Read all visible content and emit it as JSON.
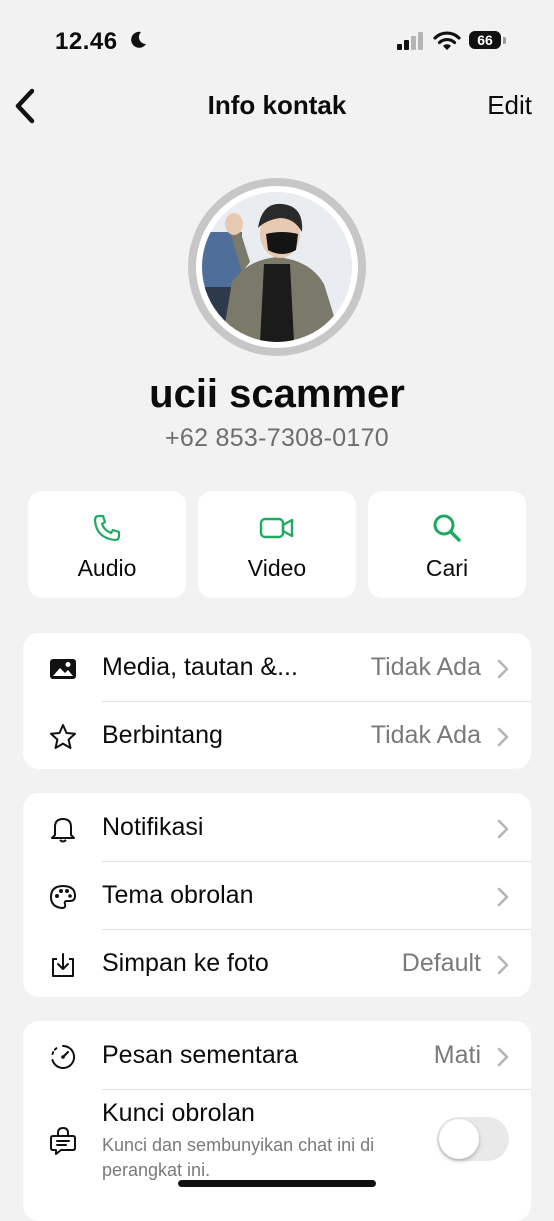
{
  "status_bar": {
    "time": "12.46",
    "battery": "66",
    "icons": [
      "moon-icon",
      "signal-icon",
      "wifi-icon",
      "battery-icon"
    ]
  },
  "nav": {
    "title": "Info kontak",
    "edit_label": "Edit",
    "back_icon": "chevron-left-icon"
  },
  "profile": {
    "name": "ucii scammer",
    "phone": "+62 853-7308-0170"
  },
  "actions": [
    {
      "label": "Audio",
      "icon": "phone-icon"
    },
    {
      "label": "Video",
      "icon": "video-icon"
    },
    {
      "label": "Cari",
      "icon": "search-icon"
    }
  ],
  "group1": [
    {
      "label": "Media, tautan &...",
      "value": "Tidak Ada",
      "icon": "image-icon"
    },
    {
      "label": "Berbintang",
      "value": "Tidak Ada",
      "icon": "star-icon"
    }
  ],
  "group2": [
    {
      "label": "Notifikasi",
      "value": "",
      "icon": "bell-icon"
    },
    {
      "label": "Tema obrolan",
      "value": "",
      "icon": "palette-icon"
    },
    {
      "label": "Simpan ke foto",
      "value": "Default",
      "icon": "save-download-icon"
    }
  ],
  "group3": {
    "disappearing": {
      "label": "Pesan sementara",
      "value": "Mati",
      "icon": "timer-icon"
    },
    "chat_lock": {
      "label": "Kunci obrolan",
      "description": "Kunci dan sembunyikan chat ini di perangkat ini.",
      "icon": "chat-lock-icon",
      "enabled": false
    }
  },
  "colors": {
    "accent": "#1daa61",
    "background": "#f2f2f2",
    "card": "#ffffff",
    "secondary_text": "#7a7a7a"
  }
}
